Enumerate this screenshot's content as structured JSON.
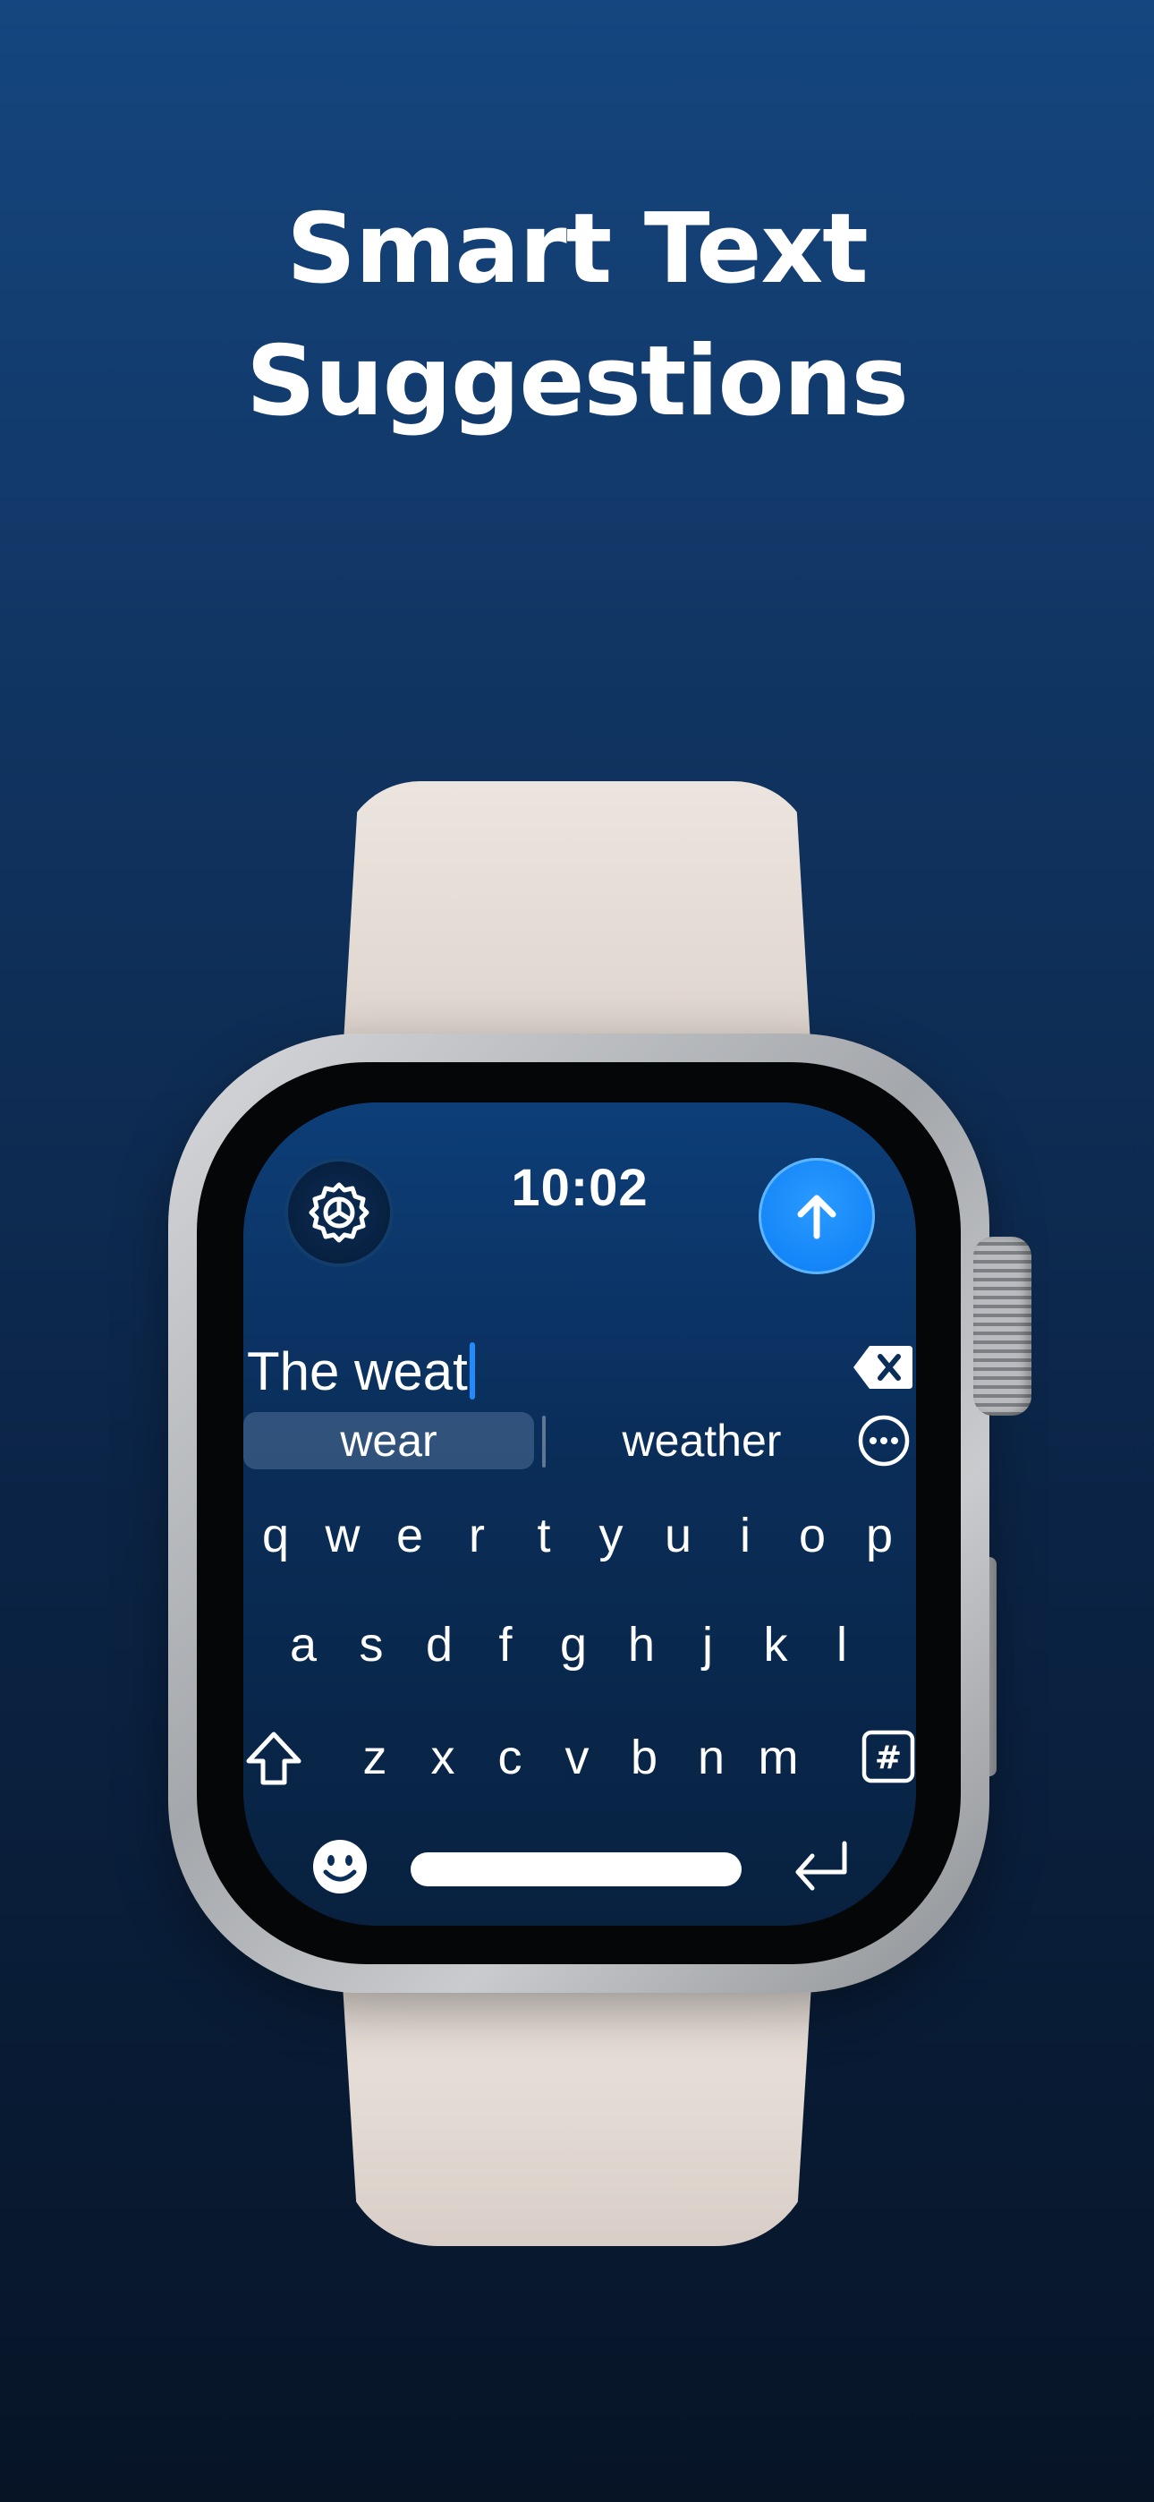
{
  "headline": {
    "line1": "Smart Text",
    "line2": "Suggestions"
  },
  "watch": {
    "time": "10:02",
    "text_input": {
      "value": "The weat"
    },
    "suggestions": [
      "wear",
      "weather"
    ],
    "keyboard": {
      "row1": [
        "q",
        "w",
        "e",
        "r",
        "t",
        "y",
        "u",
        "i",
        "o",
        "p"
      ],
      "row2": [
        "a",
        "s",
        "d",
        "f",
        "g",
        "h",
        "j",
        "k",
        "l"
      ],
      "row3": [
        "z",
        "x",
        "c",
        "v",
        "b",
        "n",
        "m"
      ],
      "hash_key": "#"
    },
    "icons": {
      "settings": "gear-icon",
      "send": "arrow-up-icon",
      "delete": "backspace-icon",
      "more": "ellipsis-circle-icon",
      "shift": "shift-icon",
      "emoji": "emoji-icon",
      "return": "return-icon"
    },
    "colors": {
      "accent": "#0a7cf5",
      "cursor": "#1f8bff"
    }
  }
}
